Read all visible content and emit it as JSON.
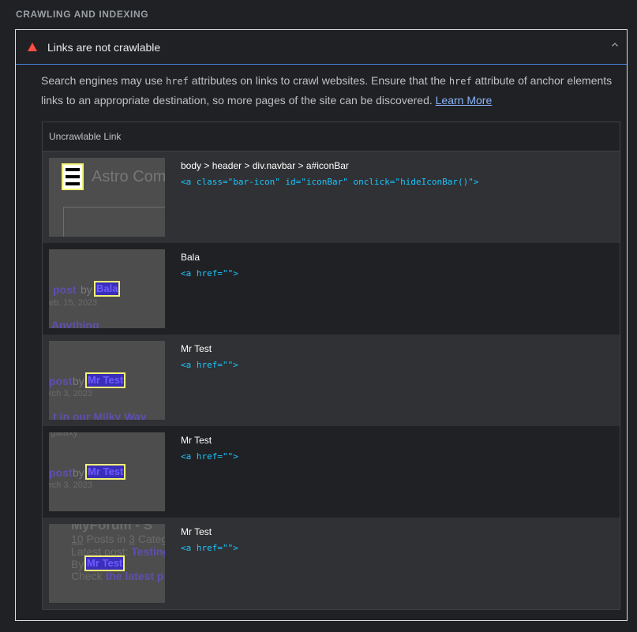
{
  "section": {
    "title": "CRAWLING AND INDEXING"
  },
  "audit": {
    "title": "Links are not crawlable",
    "description": {
      "part1": "Search engines may use ",
      "code1": "href",
      "part2": " attributes on links to crawl websites. Ensure that the ",
      "code2": "href",
      "part3": " attribute of anchor elements links to an appropriate destination, so more pages of the site can be discovered. ",
      "learn_more": "Learn More"
    },
    "icons": {
      "status": "fail-triangle-icon",
      "toggle": "chevron-up-icon"
    },
    "colors": {
      "fail": "#ff4e42",
      "link": "#8ab4f8",
      "snippet": "#1ac6ff",
      "highlight": "#f2f277"
    }
  },
  "table": {
    "header": "Uncrawlable Link",
    "rows": [
      {
        "label": "body > header > div.navbar > a#iconBar",
        "snippet": "<a class=\"bar-icon\" id=\"iconBar\" onclick=\"hideIconBar()\">",
        "thumb": {
          "ghost": "Astro Com"
        }
      },
      {
        "label": "Bala",
        "snippet": "<a href=\"\">",
        "thumb": {
          "prefix": "post",
          "by": "by",
          "highlight": "Bala",
          "date": "eb. 15, 2023",
          "below": "Anything"
        }
      },
      {
        "label": "Mr Test",
        "snippet": "<a href=\"\">",
        "thumb": {
          "prefix": "post",
          "by": "by",
          "highlight": "Mr Test",
          "date": "rch 3, 2023",
          "below": "t in our Milky Way"
        }
      },
      {
        "label": "Mr Test",
        "snippet": "<a href=\"\">",
        "thumb": {
          "top": "galaxy",
          "prefix": "post",
          "by": "by",
          "highlight": "Mr Test",
          "date": "rch 3, 2023"
        }
      },
      {
        "label": "Mr Test",
        "snippet": "<a href=\"\">",
        "thumb": {
          "top": "MyForum - S",
          "line1_num1": "10",
          "line1_mid": " Posts in ",
          "line1_num2": "3",
          "line1_end": " Categ",
          "line2_pre": "Latest post: ",
          "line2_link": "Testing",
          "line3_pre": "By ",
          "highlight": "Mr Test",
          "line4_pre": "Check ",
          "line4_link": "the latest p"
        }
      }
    ]
  }
}
